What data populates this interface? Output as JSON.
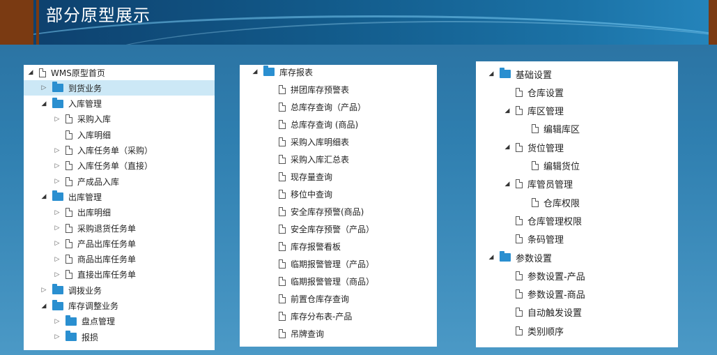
{
  "slide": {
    "title": "部分原型展示"
  },
  "panel1": {
    "items": [
      {
        "label": "WMS原型首页",
        "depth": 0,
        "toggle": "expanded",
        "icon": "file"
      },
      {
        "label": "到货业务",
        "depth": 1,
        "toggle": "collapsed",
        "icon": "folder",
        "selected": true
      },
      {
        "label": "入库管理",
        "depth": 1,
        "toggle": "expanded",
        "icon": "folder"
      },
      {
        "label": "采购入库",
        "depth": 2,
        "toggle": "collapsed",
        "icon": "file"
      },
      {
        "label": "入库明细",
        "depth": 2,
        "toggle": "none",
        "icon": "file"
      },
      {
        "label": "入库任务单（采购）",
        "depth": 2,
        "toggle": "collapsed",
        "icon": "file"
      },
      {
        "label": "入库任务单（直接）",
        "depth": 2,
        "toggle": "collapsed",
        "icon": "file"
      },
      {
        "label": "产成品入库",
        "depth": 2,
        "toggle": "collapsed",
        "icon": "file"
      },
      {
        "label": "出库管理",
        "depth": 1,
        "toggle": "expanded",
        "icon": "folder"
      },
      {
        "label": "出库明细",
        "depth": 2,
        "toggle": "collapsed",
        "icon": "file"
      },
      {
        "label": "采购退货任务单",
        "depth": 2,
        "toggle": "collapsed",
        "icon": "file"
      },
      {
        "label": "产品出库任务单",
        "depth": 2,
        "toggle": "collapsed",
        "icon": "file"
      },
      {
        "label": "商品出库任务单",
        "depth": 2,
        "toggle": "collapsed",
        "icon": "file"
      },
      {
        "label": "直接出库任务单",
        "depth": 2,
        "toggle": "collapsed",
        "icon": "file"
      },
      {
        "label": "调拨业务",
        "depth": 1,
        "toggle": "collapsed",
        "icon": "folder"
      },
      {
        "label": "库存调整业务",
        "depth": 1,
        "toggle": "expanded",
        "icon": "folder"
      },
      {
        "label": "盘点管理",
        "depth": 2,
        "toggle": "collapsed",
        "icon": "folder"
      },
      {
        "label": "报损",
        "depth": 2,
        "toggle": "collapsed",
        "icon": "folder"
      }
    ]
  },
  "panel2": {
    "items": [
      {
        "label": "库存报表",
        "depth": 0,
        "toggle": "expanded",
        "icon": "folder"
      },
      {
        "label": "拼团库存预警表",
        "depth": 1,
        "toggle": "none",
        "icon": "file"
      },
      {
        "label": "总库存查询（产品）",
        "depth": 1,
        "toggle": "none",
        "icon": "file"
      },
      {
        "label": "总库存查询 (商品)",
        "depth": 1,
        "toggle": "none",
        "icon": "file"
      },
      {
        "label": "采购入库明细表",
        "depth": 1,
        "toggle": "none",
        "icon": "file"
      },
      {
        "label": "采购入库汇总表",
        "depth": 1,
        "toggle": "none",
        "icon": "file"
      },
      {
        "label": "现存量查询",
        "depth": 1,
        "toggle": "none",
        "icon": "file"
      },
      {
        "label": "移位中查询",
        "depth": 1,
        "toggle": "none",
        "icon": "file"
      },
      {
        "label": "安全库存预警(商品)",
        "depth": 1,
        "toggle": "none",
        "icon": "file"
      },
      {
        "label": "安全库存预警（产品）",
        "depth": 1,
        "toggle": "none",
        "icon": "file"
      },
      {
        "label": "库存报警看板",
        "depth": 1,
        "toggle": "none",
        "icon": "file"
      },
      {
        "label": "临期报警管理（产品）",
        "depth": 1,
        "toggle": "none",
        "icon": "file"
      },
      {
        "label": "临期报警管理（商品）",
        "depth": 1,
        "toggle": "none",
        "icon": "file"
      },
      {
        "label": "前置仓库存查询",
        "depth": 1,
        "toggle": "none",
        "icon": "file"
      },
      {
        "label": "库存分布表-产品",
        "depth": 1,
        "toggle": "none",
        "icon": "file"
      },
      {
        "label": "吊牌查询",
        "depth": 1,
        "toggle": "none",
        "icon": "file"
      }
    ]
  },
  "panel3": {
    "items": [
      {
        "label": "基础设置",
        "depth": 0,
        "toggle": "expanded",
        "icon": "folder"
      },
      {
        "label": "仓库设置",
        "depth": 1,
        "toggle": "none",
        "icon": "file"
      },
      {
        "label": "库区管理",
        "depth": 1,
        "toggle": "expanded",
        "icon": "file"
      },
      {
        "label": "编辑库区",
        "depth": 2,
        "toggle": "none",
        "icon": "file"
      },
      {
        "label": "货位管理",
        "depth": 1,
        "toggle": "expanded",
        "icon": "file"
      },
      {
        "label": "编辑货位",
        "depth": 2,
        "toggle": "none",
        "icon": "file"
      },
      {
        "label": "库管员管理",
        "depth": 1,
        "toggle": "expanded",
        "icon": "file"
      },
      {
        "label": "仓库权限",
        "depth": 2,
        "toggle": "none",
        "icon": "file"
      },
      {
        "label": "仓库管理权限",
        "depth": 1,
        "toggle": "none",
        "icon": "file"
      },
      {
        "label": "条码管理",
        "depth": 1,
        "toggle": "none",
        "icon": "file"
      },
      {
        "label": "参数设置",
        "depth": 0,
        "toggle": "expanded",
        "icon": "folder"
      },
      {
        "label": "参数设置-产品",
        "depth": 1,
        "toggle": "none",
        "icon": "file"
      },
      {
        "label": "参数设置-商品",
        "depth": 1,
        "toggle": "none",
        "icon": "file"
      },
      {
        "label": "自动触发设置",
        "depth": 1,
        "toggle": "none",
        "icon": "file"
      },
      {
        "label": "类别顺序",
        "depth": 1,
        "toggle": "none",
        "icon": "file"
      }
    ]
  }
}
